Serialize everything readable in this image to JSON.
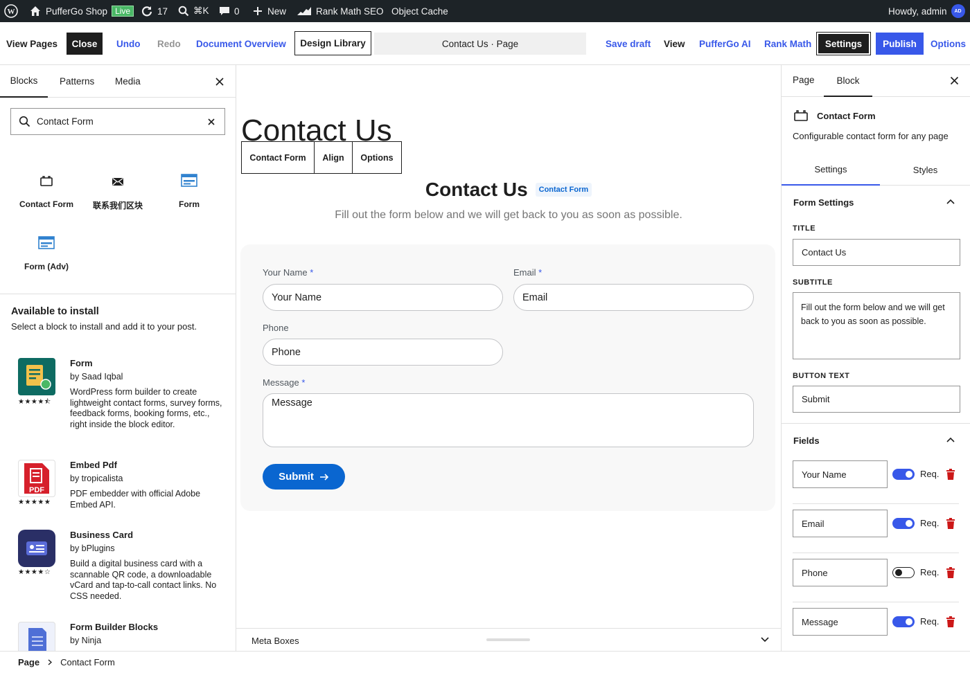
{
  "admin_bar": {
    "site_name": "PufferGo Shop",
    "live_badge": "Live",
    "updates_count": "17",
    "search_shortcut": "⌘K",
    "comments_count": "0",
    "new_label": "New",
    "rank_math_label": "Rank Math SEO",
    "object_cache_label": "Object Cache",
    "howdy": "Howdy, admin",
    "avatar_initials": "AD"
  },
  "toolbar": {
    "view_pages": "View Pages",
    "close": "Close",
    "undo": "Undo",
    "redo": "Redo",
    "document_overview": "Document Overview",
    "design_library": "Design Library",
    "doc_title": "Contact Us · Page",
    "save_draft": "Save draft",
    "view": "View",
    "ai": "PufferGo AI",
    "rank_math": "Rank Math",
    "settings": "Settings",
    "publish": "Publish",
    "options": "Options"
  },
  "inserter": {
    "tabs": [
      "Blocks",
      "Patterns",
      "Media"
    ],
    "search_value": "Contact Form",
    "blocks": [
      {
        "label": "Contact Form",
        "icon": "card-icon"
      },
      {
        "label": "联系我们区块",
        "icon": "envelope-icon"
      },
      {
        "label": "Form",
        "icon": "form-icon"
      },
      {
        "label": "Form (Adv)",
        "icon": "form-adv-icon"
      }
    ],
    "install_title": "Available to install",
    "install_desc": "Select a block to install and add it to your post.",
    "plugins": [
      {
        "name": "Form",
        "by": "by Saad Iqbal",
        "desc": "WordPress form builder to create lightweight contact forms, survey forms, feedback forms, booking forms, etc., right inside the block editor.",
        "stars": "★★★★⯪",
        "rating": 4.5
      },
      {
        "name": "Embed Pdf",
        "by": "by tropicalista",
        "desc": "PDF embedder with official Adobe Embed API.",
        "stars": "★★★★★",
        "rating": 5
      },
      {
        "name": "Business Card",
        "by": "by bPlugins",
        "desc": "Build a digital business card with a scannable QR code, a downloadable vCard and tap-to-call contact links. No CSS needed.",
        "stars": "★★★★☆",
        "rating": 4
      },
      {
        "name": "Form Builder Blocks",
        "by": "by Ninja",
        "desc": "",
        "stars": "",
        "rating": null
      }
    ]
  },
  "canvas": {
    "page_title": "Contact Us",
    "block_toolbar": [
      "Contact Form",
      "Align",
      "Options"
    ],
    "form_title": "Contact Us",
    "form_badge": "Contact Form",
    "form_subtitle": "Fill out the form below and we will get back to you as soon as possible.",
    "fields": {
      "name_label": "Your Name",
      "name_placeholder": "Your Name",
      "email_label": "Email",
      "email_placeholder": "Email",
      "phone_label": "Phone",
      "phone_placeholder": "Phone",
      "message_label": "Message",
      "message_placeholder": "Message",
      "required_mark": "*"
    },
    "submit": "Submit",
    "meta_boxes": "Meta Boxes"
  },
  "sidebar": {
    "tabs": [
      "Page",
      "Block"
    ],
    "block_name": "Contact Form",
    "block_desc": "Configurable contact form for any page",
    "subtabs": [
      "Settings",
      "Styles"
    ],
    "form_settings_title": "Form Settings",
    "title_label": "TITLE",
    "title_value": "Contact Us",
    "subtitle_label": "SUBTITLE",
    "subtitle_value": "Fill out the form below and we will get back to you as soon as possible.",
    "button_label": "BUTTON TEXT",
    "button_value": "Submit",
    "fields_title": "Fields",
    "req_label": "Req.",
    "field_rows": [
      {
        "name": "Your Name",
        "required": true
      },
      {
        "name": "Email",
        "required": true
      },
      {
        "name": "Phone",
        "required": false
      },
      {
        "name": "Message",
        "required": true
      }
    ]
  },
  "breadcrumb": [
    "Page",
    "Contact Form"
  ],
  "colors": {
    "accent": "#3858e9",
    "submit_button": "#0a66d0",
    "delete": "#cc1818",
    "admin_bar": "#1d2327"
  }
}
